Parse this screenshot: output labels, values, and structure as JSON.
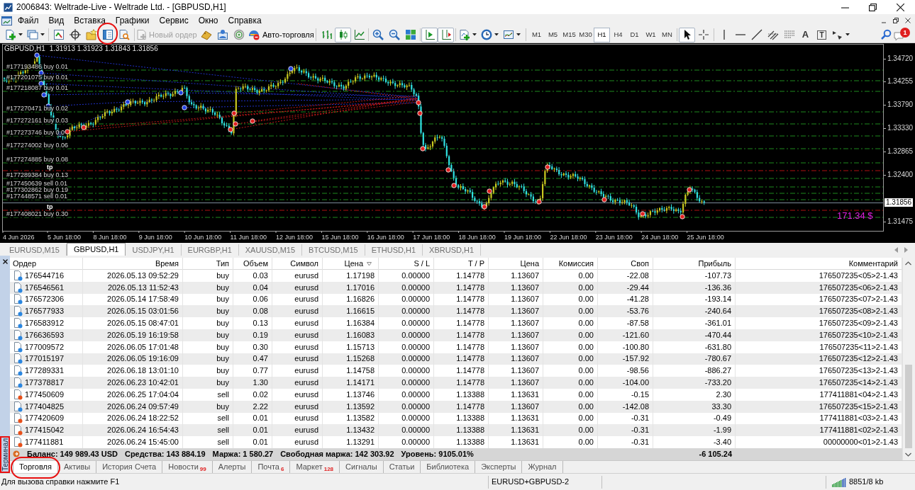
{
  "window": {
    "title": "2006843: Weltrade-Live - Weltrade Ltd. - [GBPUSD,H1]"
  },
  "menu": [
    "Файл",
    "Вид",
    "Вставка",
    "Графики",
    "Сервис",
    "Окно",
    "Справка"
  ],
  "toolbar": {
    "circled_icon": true,
    "new_order": {
      "label": "Новый ордер",
      "disabled": true
    },
    "autotrading": {
      "label": "Авто-торговля"
    },
    "chart_types": [
      {
        "selected": false
      },
      {
        "selected": true
      },
      {
        "selected": false
      }
    ],
    "chart_shift": {
      "on": true
    },
    "auto_scroll": {
      "on": true
    },
    "timeframes": [
      {
        "label": "M1",
        "selected": false
      },
      {
        "label": "M5",
        "selected": false
      },
      {
        "label": "M15",
        "selected": false
      },
      {
        "label": "M30",
        "selected": false
      },
      {
        "label": "H1",
        "selected": true
      },
      {
        "label": "H4",
        "selected": false
      },
      {
        "label": "D1",
        "selected": false
      },
      {
        "label": "W1",
        "selected": false
      },
      {
        "label": "MN",
        "selected": false
      }
    ],
    "pointer_tools": [
      {
        "selected": true
      },
      {
        "selected": false
      }
    ],
    "text_tools": [
      "A",
      "T"
    ],
    "notification_count": "1"
  },
  "chart": {
    "symbol": "GBPUSD,H1",
    "quotes": "1.31913 1.31923 1.31843 1.31856",
    "order_labels": [
      {
        "text": "#177193486 buy 0.01",
        "kind": "order"
      },
      {
        "text": "#177201075 buy 0.01",
        "kind": "order"
      },
      {
        "text": "#177218087 buy 0.01",
        "kind": "order"
      },
      {
        "text": "#177270471 buy 0.02",
        "kind": "order"
      },
      {
        "text": "#177272161 buy 0.03",
        "kind": "order"
      },
      {
        "text": "#177273746 buy 0.0",
        "kind": "order"
      },
      {
        "text": "#177274002 buy 0.06",
        "kind": "order"
      },
      {
        "text": "#177274885 buy 0.08",
        "kind": "order"
      },
      {
        "text": "tp",
        "kind": "tp"
      },
      {
        "text": "#177289384 buy 0.13",
        "kind": "order"
      },
      {
        "text": "#177450639 sell 0.01",
        "kind": "order"
      },
      {
        "text": "#177302862 buy 0.19",
        "kind": "order"
      },
      {
        "text": "#177448571 sell 0.01",
        "kind": "order"
      },
      {
        "text": "tp",
        "kind": "tp"
      },
      {
        "text": "#177408021 buy 0.30",
        "kind": "order"
      }
    ],
    "price_labels": [
      "1.34720",
      "1.34255",
      "1.33790",
      "1.33330",
      "1.32865",
      "1.32400",
      "1.31475"
    ],
    "current_price": "1.31856",
    "profit_label": "171.34 $",
    "date_labels": [
      "4 Jun 2026",
      "5 Jun 18:00",
      "8 Jun 18:00",
      "9 Jun 18:00",
      "10 Jun 18:00",
      "11 Jun 18:00",
      "12 Jun 18:00",
      "15 Jun 18:00",
      "16 Jun 18:00",
      "17 Jun 18:00",
      "18 Jun 18:00",
      "19 Jun 18:00",
      "22 Jun 18:00",
      "23 Jun 18:00",
      "24 Jun 18:00",
      "25 Jun 18:00"
    ]
  },
  "chart_tabs": [
    {
      "label": "EURUSD,M15",
      "selected": false
    },
    {
      "label": "GBPUSD,H1",
      "selected": true
    },
    {
      "label": "USDJPY,H1",
      "selected": false
    },
    {
      "label": "EURGBP,H1",
      "selected": false
    },
    {
      "label": "XAUUSD,M15",
      "selected": false
    },
    {
      "label": "BTCUSD,M15",
      "selected": false
    },
    {
      "label": "ETHUSD,H1",
      "selected": false
    },
    {
      "label": "XBRUSD,H1",
      "selected": false
    }
  ],
  "terminal": {
    "side_label": "Терминал",
    "side_label_boxed": true,
    "columns": [
      {
        "label": "Ордер",
        "sorted": false
      },
      {
        "label": "Время",
        "sorted": false
      },
      {
        "label": "Тип",
        "sorted": false
      },
      {
        "label": "Объем",
        "sorted": false
      },
      {
        "label": "Символ",
        "sorted": false
      },
      {
        "label": "Цена",
        "sorted": true
      },
      {
        "label": "S / L",
        "sorted": false
      },
      {
        "label": "T / P",
        "sorted": false
      },
      {
        "label": "Цена",
        "sorted": false
      },
      {
        "label": "Комиссия",
        "sorted": false
      },
      {
        "label": "Своп",
        "sorted": false
      },
      {
        "label": "Прибыль",
        "sorted": false
      },
      {
        "label": "Комментарий",
        "sorted": false
      }
    ],
    "rows": [
      {
        "kind": "buy",
        "cells": [
          "176544716",
          "2026.05.13 09:52:29",
          "buy",
          "0.03",
          "eurusd",
          "1.17198",
          "0.00000",
          "1.14778",
          "1.13607",
          "0.00",
          "-22.08",
          "-107.73",
          "176507235<05>2-1.43"
        ]
      },
      {
        "kind": "buy",
        "cells": [
          "176546561",
          "2026.05.13 11:52:43",
          "buy",
          "0.04",
          "eurusd",
          "1.17016",
          "0.00000",
          "1.14778",
          "1.13607",
          "0.00",
          "-29.44",
          "-136.36",
          "176507235<06>2-1.43"
        ]
      },
      {
        "kind": "buy",
        "cells": [
          "176572306",
          "2026.05.14 17:58:49",
          "buy",
          "0.06",
          "eurusd",
          "1.16826",
          "0.00000",
          "1.14778",
          "1.13607",
          "0.00",
          "-41.28",
          "-193.14",
          "176507235<07>2-1.43"
        ]
      },
      {
        "kind": "buy",
        "cells": [
          "176577933",
          "2026.05.15 03:01:56",
          "buy",
          "0.08",
          "eurusd",
          "1.16615",
          "0.00000",
          "1.14778",
          "1.13607",
          "0.00",
          "-53.76",
          "-240.64",
          "176507235<08>2-1.43"
        ]
      },
      {
        "kind": "buy",
        "cells": [
          "176583912",
          "2026.05.15 08:47:01",
          "buy",
          "0.13",
          "eurusd",
          "1.16384",
          "0.00000",
          "1.14778",
          "1.13607",
          "0.00",
          "-87.58",
          "-361.01",
          "176507235<09>2-1.43"
        ]
      },
      {
        "kind": "buy",
        "cells": [
          "176636593",
          "2026.05.19 16:19:58",
          "buy",
          "0.19",
          "eurusd",
          "1.16083",
          "0.00000",
          "1.14778",
          "1.13607",
          "0.00",
          "-121.60",
          "-470.44",
          "176507235<10>2-1.43"
        ]
      },
      {
        "kind": "buy",
        "cells": [
          "177009572",
          "2026.06.05 17:01:48",
          "buy",
          "0.30",
          "eurusd",
          "1.15713",
          "0.00000",
          "1.14778",
          "1.13607",
          "0.00",
          "-100.80",
          "-631.80",
          "176507235<11>2-1.43"
        ]
      },
      {
        "kind": "buy",
        "cells": [
          "177015197",
          "2026.06.05 19:16:09",
          "buy",
          "0.47",
          "eurusd",
          "1.15268",
          "0.00000",
          "1.14778",
          "1.13607",
          "0.00",
          "-157.92",
          "-780.67",
          "176507235<12>2-1.43"
        ]
      },
      {
        "kind": "buy",
        "cells": [
          "177289331",
          "2026.06.18 13:01:10",
          "buy",
          "0.77",
          "eurusd",
          "1.14758",
          "0.00000",
          "1.14778",
          "1.13607",
          "0.00",
          "-98.56",
          "-886.27",
          "176507235<13>2-1.43"
        ]
      },
      {
        "kind": "buy",
        "cells": [
          "177378817",
          "2026.06.23 10:42:01",
          "buy",
          "1.30",
          "eurusd",
          "1.14171",
          "0.00000",
          "1.14778",
          "1.13607",
          "0.00",
          "-104.00",
          "-733.20",
          "176507235<14>2-1.43"
        ]
      },
      {
        "kind": "sell",
        "cells": [
          "177450609",
          "2026.06.25 17:04:04",
          "sell",
          "0.02",
          "eurusd",
          "1.13746",
          "0.00000",
          "1.13388",
          "1.13631",
          "0.00",
          "-0.15",
          "2.30",
          "177411881<04>2-1.43"
        ]
      },
      {
        "kind": "buy",
        "cells": [
          "177404825",
          "2026.06.24 09:57:49",
          "buy",
          "2.22",
          "eurusd",
          "1.13592",
          "0.00000",
          "1.14778",
          "1.13607",
          "0.00",
          "-142.08",
          "33.30",
          "176507235<15>2-1.43"
        ]
      },
      {
        "kind": "sell",
        "cells": [
          "177420609",
          "2026.06.24 18:22:52",
          "sell",
          "0.01",
          "eurusd",
          "1.13582",
          "0.00000",
          "1.13388",
          "1.13631",
          "0.00",
          "-0.31",
          "-0.49",
          "177411881<03>2-1.43"
        ]
      },
      {
        "kind": "sell",
        "cells": [
          "177415042",
          "2026.06.24 16:54:43",
          "sell",
          "0.01",
          "eurusd",
          "1.13432",
          "0.00000",
          "1.13388",
          "1.13631",
          "0.00",
          "-0.31",
          "-1.99",
          "177411881<02>2-1.43"
        ]
      },
      {
        "kind": "sell",
        "cells": [
          "177411881",
          "2026.06.24 15:45:00",
          "sell",
          "0.01",
          "eurusd",
          "1.13291",
          "0.00000",
          "1.13388",
          "1.13631",
          "0.00",
          "-0.31",
          "-3.40",
          "00000000<01>2-1.43"
        ]
      }
    ],
    "summary": {
      "items": [
        "Баланс: 149 989.43 USD",
        "Средства: 143 884.19",
        "Маржа: 1 580.27",
        "Свободная маржа: 142 303.92",
        "Уровень: 9105.01%"
      ],
      "profit": "-6 105.24"
    },
    "tabs": [
      {
        "label": "Торговля",
        "selected": true,
        "circled": true
      },
      {
        "label": "Активы",
        "selected": false,
        "circled": false
      },
      {
        "label": "История Счета",
        "selected": false,
        "circled": false
      },
      {
        "label": "Новости",
        "count": "99",
        "selected": false,
        "circled": false
      },
      {
        "label": "Алерты",
        "selected": false,
        "circled": false
      },
      {
        "label": "Почта",
        "count": "6",
        "selected": false,
        "circled": false
      },
      {
        "label": "Маркет",
        "count": "128",
        "selected": false,
        "circled": false
      },
      {
        "label": "Сигналы",
        "selected": false,
        "circled": false
      },
      {
        "label": "Статьи",
        "selected": false,
        "circled": false
      },
      {
        "label": "Библиотека",
        "selected": false,
        "circled": false
      },
      {
        "label": "Эксперты",
        "selected": false,
        "circled": false
      },
      {
        "label": "Журнал",
        "selected": false,
        "circled": false
      }
    ]
  },
  "status_bar": {
    "help": "Для вызова справки нажмите F1",
    "profile": "EURUSD+GBPUSD-2",
    "traffic": "8851/8 kb"
  }
}
